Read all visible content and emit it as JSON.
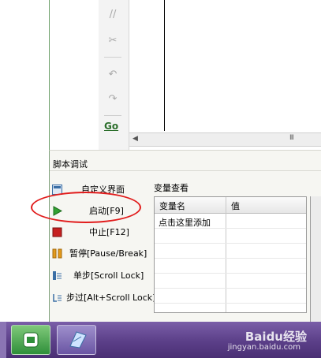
{
  "toolbar": {
    "items": [
      "comment-icon",
      "uncomment-icon",
      "undo-icon",
      "redo-icon"
    ],
    "go_label": "Go"
  },
  "debug_panel": {
    "title": "脚本调试",
    "buttons": [
      {
        "label": "自定义界面",
        "icon": "custom-ui-icon"
      },
      {
        "label": "启动[F9]",
        "icon": "play-icon"
      },
      {
        "label": "中止[F12]",
        "icon": "stop-icon"
      },
      {
        "label": "暂停[Pause/Break]",
        "icon": "pause-icon"
      },
      {
        "label": "单步[Scroll Lock]",
        "icon": "step-icon"
      },
      {
        "label": "步过[Alt+Scroll Lock]",
        "icon": "step-over-icon"
      }
    ],
    "watch": {
      "title": "变量查看",
      "col_name": "变量名",
      "col_value": "值",
      "add_row": "点击这里添加"
    }
  },
  "scrollbar": {
    "grip": "III"
  },
  "taskbar": {
    "apps": [
      "app-green-icon",
      "app-blue-icon"
    ],
    "watermark": "Baidu经验",
    "watermark_url": "jingyan.baidu.com"
  },
  "colors": {
    "highlight": "#e11c1c",
    "taskbar": "#5b3f88",
    "play": "#33a133",
    "stop": "#c62020",
    "pause": "#e39a1c"
  }
}
